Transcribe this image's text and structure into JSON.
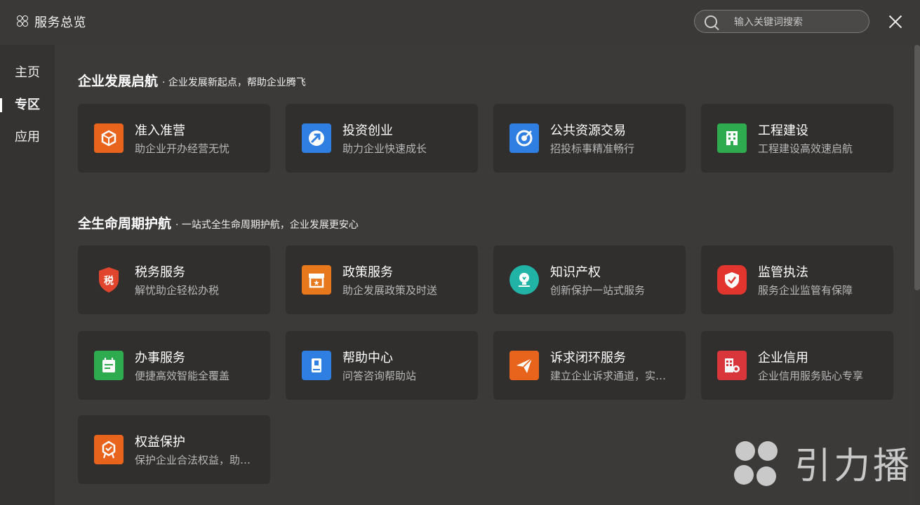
{
  "header": {
    "title": "服务总览",
    "search_placeholder": "输入关键词搜索"
  },
  "sidebar": {
    "items": [
      {
        "label": "主页"
      },
      {
        "label": "专区",
        "active": true
      },
      {
        "label": "应用"
      }
    ]
  },
  "sections": [
    {
      "title": "企业发展启航",
      "subtitle": "· 企业发展新起点，帮助企业腾飞",
      "cards": [
        {
          "title": "准入准营",
          "desc": "助企业开办经营无忧",
          "icon": "box-icon",
          "color": "#e8641c"
        },
        {
          "title": "投资创业",
          "desc": "助力企业快速成长",
          "icon": "growth-arrow-icon",
          "color": "#2f7fe3"
        },
        {
          "title": "公共资源交易",
          "desc": "招投标事精准畅行",
          "icon": "target-icon",
          "color": "#2f7fe3"
        },
        {
          "title": "工程建设",
          "desc": "工程建设高效速启航",
          "icon": "building-icon",
          "color": "#2eab4f"
        }
      ]
    },
    {
      "title": "全生命周期护航",
      "subtitle": "· 一站式全生命周期护航，企业发展更安心",
      "cards": [
        {
          "title": "税务服务",
          "desc": "解忧助企轻松办税",
          "icon": "tax-shield-icon",
          "color": "#e2452d",
          "glyph": "税"
        },
        {
          "title": "政策服务",
          "desc": "助企发展政策及时送",
          "icon": "policy-box-icon",
          "color": "#e8781c"
        },
        {
          "title": "知识产权",
          "desc": "创新保护一站式服务",
          "icon": "lightbulb-icon",
          "color": "#21b3a5"
        },
        {
          "title": "监管执法",
          "desc": "服务企业监管有保障",
          "icon": "shield-check-icon",
          "color": "#e2352d"
        },
        {
          "title": "办事服务",
          "desc": "便捷高效智能全覆盖",
          "icon": "calendar-icon",
          "color": "#2eab4f"
        },
        {
          "title": "帮助中心",
          "desc": "问答咨询帮助站",
          "icon": "book-icon",
          "color": "#2f7fe3"
        },
        {
          "title": "诉求闭环服务",
          "desc": "建立企业诉求通道，实现诉求闭环",
          "icon": "paper-plane-icon",
          "color": "#e8641c"
        },
        {
          "title": "企业信用",
          "desc": "企业信用服务贴心专享",
          "icon": "credit-building-icon",
          "color": "#d8363a"
        },
        {
          "title": "权益保护",
          "desc": "保护企业合法权益，助力企业发展",
          "icon": "badge-icon",
          "color": "#e8641c"
        }
      ]
    }
  ],
  "watermark": {
    "text": "引力播"
  }
}
